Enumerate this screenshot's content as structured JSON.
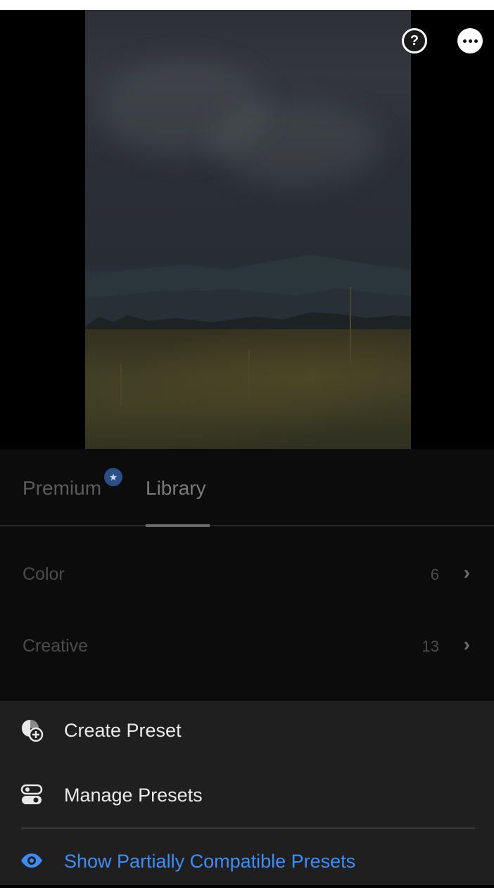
{
  "photo": {
    "help_icon": "help-circle-icon",
    "more_icon": "more-horizontal-icon"
  },
  "tabs": [
    {
      "label": "Premium",
      "badge_icon": "star-icon"
    },
    {
      "label": "Library",
      "selected": true
    }
  ],
  "library_items": [
    {
      "label": "Color",
      "count": "6"
    },
    {
      "label": "Creative",
      "count": "13"
    }
  ],
  "menu": {
    "create_preset": "Create Preset",
    "manage_presets": "Manage Presets",
    "show_partial": "Show Partially Compatible Presets"
  },
  "colors": {
    "accent_blue": "#3d8df7",
    "sheet_bg": "#1f1f1f",
    "badge_blue": "#2a4f86"
  }
}
